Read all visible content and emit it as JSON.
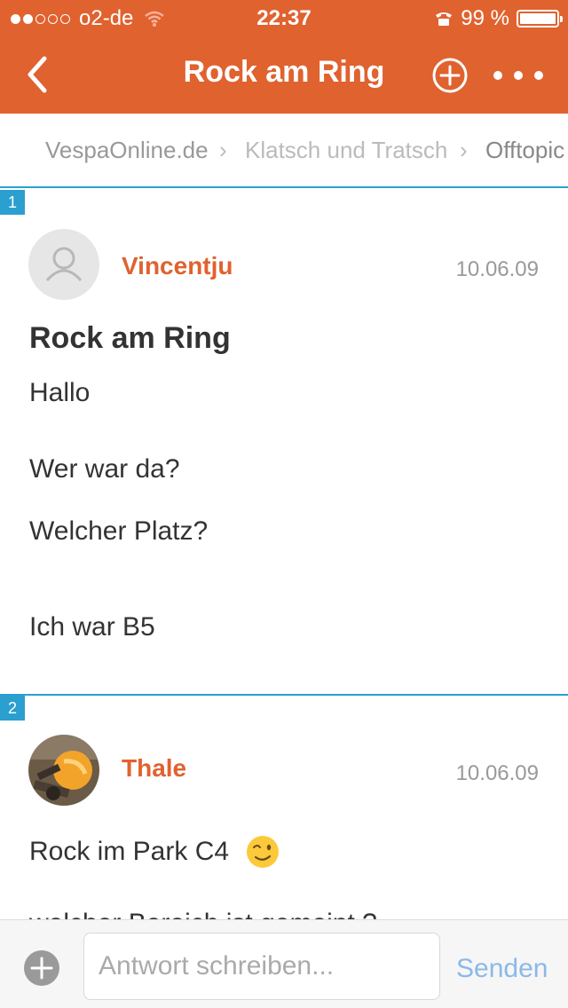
{
  "status_bar": {
    "carrier": "o2-de",
    "time": "22:37",
    "battery": "99 %",
    "battery_level": 0.99,
    "signal_bars_filled": 2,
    "signal_bars_total": 5
  },
  "nav": {
    "title": "Rock am Ring"
  },
  "breadcrumb": {
    "items": [
      "VespaOnline.de",
      "Klatsch und Tratsch",
      "Offtopic"
    ]
  },
  "posts": [
    {
      "number": "1",
      "author": "Vincentju",
      "date": "10.06.09",
      "title": "Rock am Ring",
      "lines": [
        "Hallo",
        "Wer war da?",
        "Welcher Platz?",
        "Ich war B5"
      ]
    },
    {
      "number": "2",
      "author": "Thale",
      "date": "10.06.09",
      "lines": [
        "Rock im Park C4",
        "welcher Bereich  ist  gemeint  ?"
      ]
    }
  ],
  "reply": {
    "placeholder": "Antwort schreiben...",
    "send_label": "Senden"
  },
  "colors": {
    "accent": "#e0622f",
    "post_divider": "#2a9fd0",
    "send": "#8ab9e8"
  },
  "icons": {
    "back": "chevron-left-icon",
    "add": "plus-circle-icon",
    "more": "more-dots-icon",
    "emoji": "wink-emoji-icon",
    "attach": "plus-icon"
  }
}
